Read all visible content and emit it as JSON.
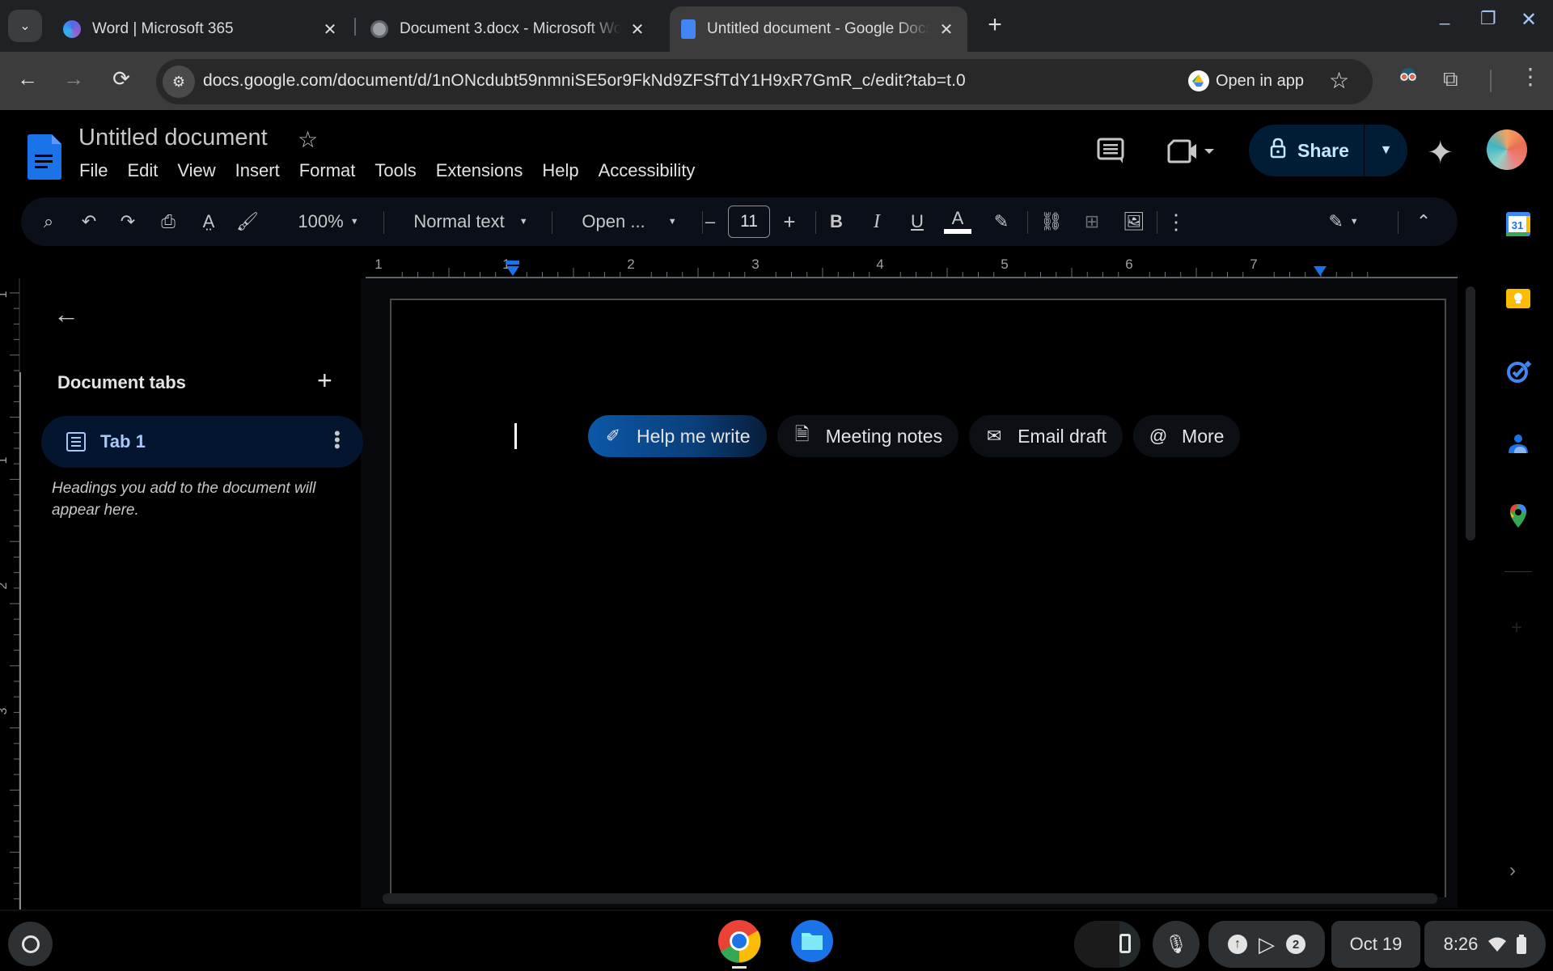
{
  "browser": {
    "tabs": [
      {
        "title": "Word | Microsoft 365",
        "icon": "microsoft-365-copilot-icon",
        "active": false
      },
      {
        "title": "Document 3.docx - Microsoft Word",
        "icon": "globe-icon",
        "active": false
      },
      {
        "title": "Untitled document - Google Docs",
        "icon": "google-docs-icon",
        "active": true
      }
    ],
    "new_tab_label": "+",
    "window_controls": {
      "minimize": "_",
      "restore": "❐",
      "close": "✕"
    },
    "url": "docs.google.com/document/d/1nONcdubt59nmniSE5or9FkNd9ZFSfTdY1H9xR7GmR_c/edit?tab=t.0",
    "open_in_app_label": "Open in app"
  },
  "docs": {
    "title": "Untitled document",
    "menu": [
      "File",
      "Edit",
      "View",
      "Insert",
      "Format",
      "Tools",
      "Extensions",
      "Help",
      "Accessibility"
    ],
    "share_label": "Share",
    "toolbar": {
      "zoom": "100%",
      "style": "Normal text",
      "font": "Open ...",
      "font_size": "11",
      "minus": "–",
      "plus": "+",
      "bold": "B",
      "italic": "I",
      "underline": "U",
      "text_color": "A",
      "text_color_value": "#ffffff"
    },
    "ruler": {
      "horizontal_labels": [
        "1",
        "1",
        "2",
        "3",
        "4",
        "5",
        "6",
        "7"
      ],
      "vertical_labels": [
        "1",
        "1",
        "2",
        "3"
      ]
    },
    "outline": {
      "heading": "Document tabs",
      "add": "+",
      "tabs": [
        {
          "label": "Tab 1",
          "selected": true
        }
      ],
      "hint": "Headings you add to the document will appear here."
    },
    "chips": [
      {
        "label": "Help me write",
        "icon": "magic-pen-icon",
        "primary": true
      },
      {
        "label": "Meeting notes",
        "icon": "document-icon",
        "primary": false
      },
      {
        "label": "Email draft",
        "icon": "email-forward-icon",
        "primary": false
      },
      {
        "label": "More",
        "icon": "at-sign-icon",
        "primary": false
      }
    ]
  },
  "side_panel": [
    "Calendar",
    "Keep",
    "Tasks",
    "Contacts",
    "Maps"
  ],
  "shelf": {
    "date": "Oct 19",
    "time": "8:26",
    "notification_count": "2"
  }
}
